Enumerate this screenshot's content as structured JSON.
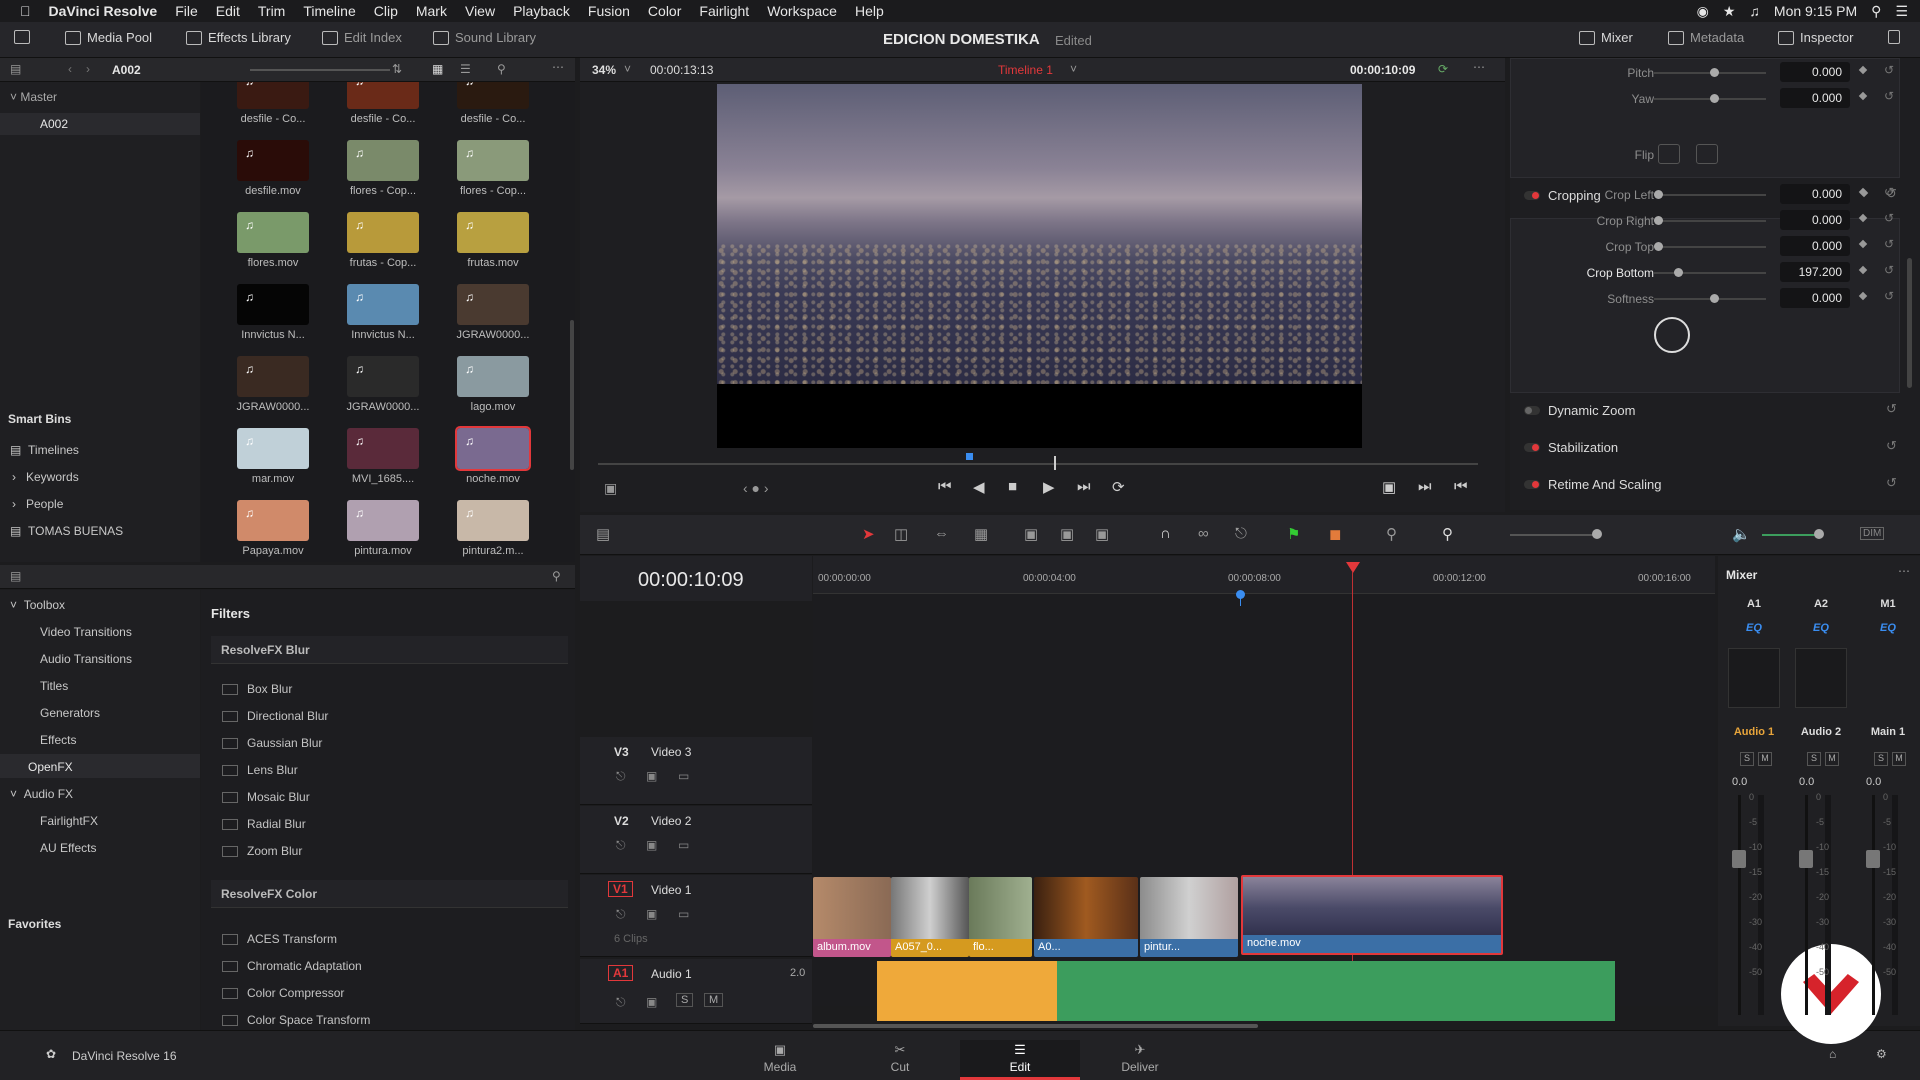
{
  "menubar": {
    "app_name": "DaVinci Resolve",
    "items": [
      "File",
      "Edit",
      "Trim",
      "Timeline",
      "Clip",
      "Mark",
      "View",
      "Playback",
      "Fusion",
      "Color",
      "Fairlight",
      "Workspace",
      "Help"
    ],
    "clock": "Mon 9:15 PM"
  },
  "toolbar": {
    "media_pool": "Media Pool",
    "effects_library": "Effects Library",
    "edit_index": "Edit Index",
    "sound_library": "Sound Library",
    "project_title": "EDICION DOMESTIKA",
    "project_status": "Edited",
    "mixer": "Mixer",
    "metadata": "Metadata",
    "inspector": "Inspector"
  },
  "media_pool": {
    "current_bin": "A002",
    "master": "Master",
    "bin": "A002",
    "clips": [
      [
        "desfile - Co...",
        "desfile - Co...",
        "desfile - Co..."
      ],
      [
        "desfile.mov",
        "flores - Cop...",
        "flores - Cop..."
      ],
      [
        "flores.mov",
        "frutas - Cop...",
        "frutas.mov"
      ],
      [
        "Innvictus N...",
        "Innvictus N...",
        "JGRAW0000..."
      ],
      [
        "JGRAW0000...",
        "JGRAW0000...",
        "lago.mov"
      ],
      [
        "mar.mov",
        "MVI_1685....",
        "noche.mov"
      ],
      [
        "Papaya.mov",
        "pintura.mov",
        "pintura2.m..."
      ]
    ],
    "smart_bins": "Smart Bins",
    "smart_items": [
      "Timelines",
      "Keywords",
      "People",
      "TOMAS BUENAS"
    ]
  },
  "effects": {
    "toolbox": "Toolbox",
    "tree": [
      "Video Transitions",
      "Audio Transitions",
      "Titles",
      "Generators",
      "Effects"
    ],
    "openfx": "OpenFX",
    "audio_fx": "Audio FX",
    "audio_items": [
      "FairlightFX",
      "AU Effects"
    ],
    "favorites": "Favorites",
    "filters_title": "Filters",
    "group1": "ResolveFX Blur",
    "blur": [
      "Box Blur",
      "Directional Blur",
      "Gaussian Blur",
      "Lens Blur",
      "Mosaic Blur",
      "Radial Blur",
      "Zoom Blur"
    ],
    "group2": "ResolveFX Color",
    "color": [
      "ACES Transform",
      "Chromatic Adaptation",
      "Color Compressor",
      "Color Space Transform"
    ]
  },
  "viewer": {
    "zoom": "34%",
    "source_tc": "00:00:13:13",
    "timeline_name": "Timeline 1",
    "record_tc": "00:00:10:09"
  },
  "inspector": {
    "pitch_label": "Pitch",
    "pitch": "0.000",
    "yaw_label": "Yaw",
    "yaw": "0.000",
    "flip_label": "Flip",
    "cropping": "Cropping",
    "crop_left_label": "Crop Left",
    "crop_left": "0.000",
    "crop_right_label": "Crop Right",
    "crop_right": "0.000",
    "crop_top_label": "Crop Top",
    "crop_top": "0.000",
    "crop_bottom_label": "Crop Bottom",
    "crop_bottom": "197.200",
    "softness_label": "Softness",
    "softness": "0.000",
    "dynamic_zoom": "Dynamic Zoom",
    "stabilization": "Stabilization",
    "retime": "Retime And Scaling"
  },
  "timeline": {
    "timecode": "00:00:10:09",
    "ruler": [
      "00:00:00:00",
      "00:00:04:00",
      "00:00:08:00",
      "00:00:12:00",
      "00:00:16:00"
    ],
    "v3_id": "V3",
    "v3_name": "Video 3",
    "v2_id": "V2",
    "v2_name": "Video 2",
    "v1_id": "V1",
    "v1_name": "Video 1",
    "v1_count": "6 Clips",
    "a1_id": "A1",
    "a1_name": "Audio 1",
    "a1_ch": "2.0",
    "clips": [
      "album.mov",
      "A057_0...",
      "flo...",
      "A0...",
      "pintur...",
      "noche.mov"
    ],
    "solo": "S",
    "mute": "M"
  },
  "mixer": {
    "title": "Mixer",
    "channels": [
      "A1",
      "A2",
      "M1"
    ],
    "eq": "EQ",
    "names": [
      "Audio 1",
      "Audio 2",
      "Main 1"
    ],
    "levels": [
      "0.0",
      "0.0",
      "0.0"
    ],
    "scale": [
      "0",
      "-5",
      "-10",
      "-15",
      "-20",
      "-30",
      "-40",
      "-50"
    ]
  },
  "bottom": {
    "product": "DaVinci Resolve 16",
    "pages": [
      "Media",
      "Cut",
      "Edit",
      "Deliver"
    ],
    "active_page": "Edit"
  },
  "colors": {
    "accent": "#e2383b",
    "video_clip": "#3b6fa6",
    "audio_clip": "#3c9d5d",
    "active_tab": "#e2383b"
  }
}
